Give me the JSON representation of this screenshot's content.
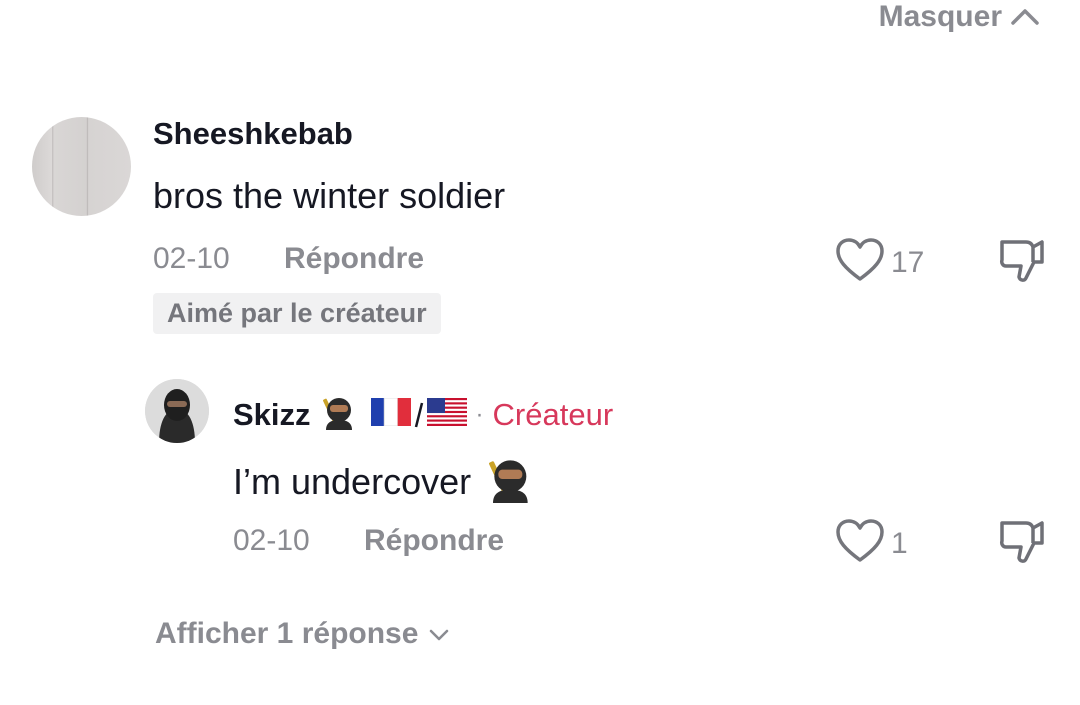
{
  "header": {
    "hide_label": "Masquer"
  },
  "comment": {
    "username": "Sheeshkebab",
    "text": "bros the winter soldier",
    "date": "02-10",
    "reply_label": "Répondre",
    "likes": "17",
    "badge": "Aimé par le créateur"
  },
  "reply": {
    "username": "Skizz",
    "separator": "·",
    "creator_label": "Créateur",
    "text": "I’m undercover",
    "date": "02-10",
    "reply_label": "Répondre",
    "likes": "1"
  },
  "footer": {
    "more_replies": "Afficher 1 réponse"
  },
  "colors": {
    "accent_creator": "#d7385b",
    "muted": "#8a8b91",
    "text": "#161823"
  },
  "icons": [
    "chevron-up-icon",
    "heart-outline-icon",
    "dislike-icon",
    "ninja-emoji",
    "flag-fr-emoji",
    "flag-us-emoji",
    "chevron-down-icon"
  ]
}
